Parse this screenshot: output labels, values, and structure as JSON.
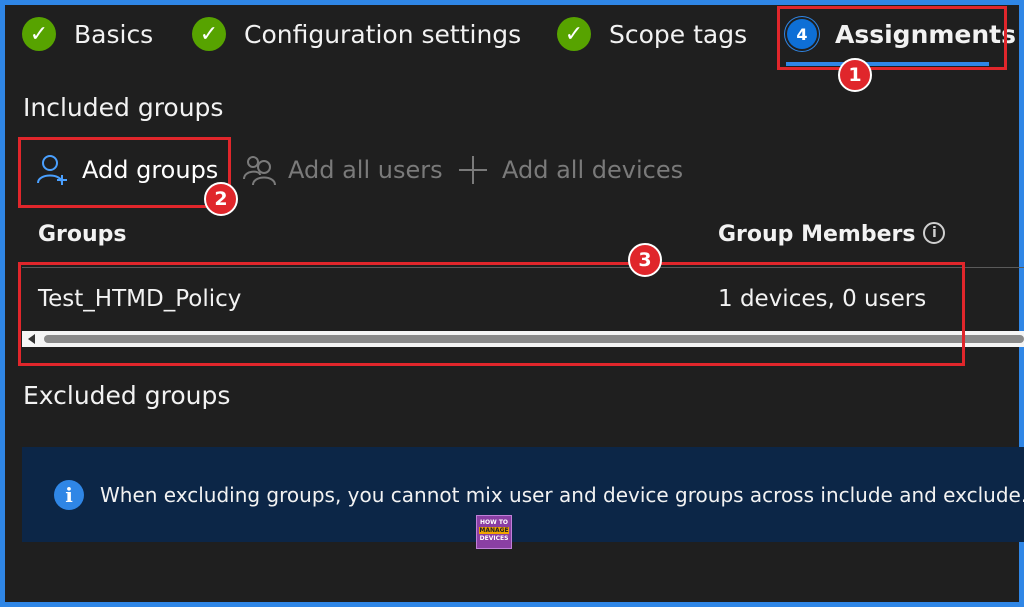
{
  "steps": [
    {
      "label": "Basics",
      "status": "complete"
    },
    {
      "label": "Configuration settings",
      "status": "complete"
    },
    {
      "label": "Scope tags",
      "status": "complete"
    },
    {
      "label": "Assignments",
      "number": "4",
      "status": "current"
    }
  ],
  "callouts": [
    "1",
    "2",
    "3"
  ],
  "included": {
    "title": "Included groups",
    "actions": {
      "add_groups": "Add groups",
      "add_all_users": "Add all users",
      "add_all_devices": "Add all devices"
    },
    "table": {
      "headers": {
        "groups": "Groups",
        "members": "Group Members"
      },
      "rows": [
        {
          "group": "Test_HTMD_Policy",
          "members": "1 devices, 0 users"
        }
      ]
    }
  },
  "excluded": {
    "title": "Excluded groups",
    "info_text": "When excluding groups, you cannot mix user and device groups across include and exclude."
  },
  "logo": {
    "line1": "HOW TO",
    "line2": "MANAGE",
    "line3": "DEVICES"
  },
  "colors": {
    "accent": "#2f86e6",
    "success": "#57a300",
    "annotation": "#e0262b",
    "banner": "#0c2647"
  },
  "icons": {
    "step_complete": "check-icon",
    "info": "info-icon",
    "add_group": "add-person-icon",
    "all_users": "people-icon",
    "all_devices": "plus-icon"
  }
}
